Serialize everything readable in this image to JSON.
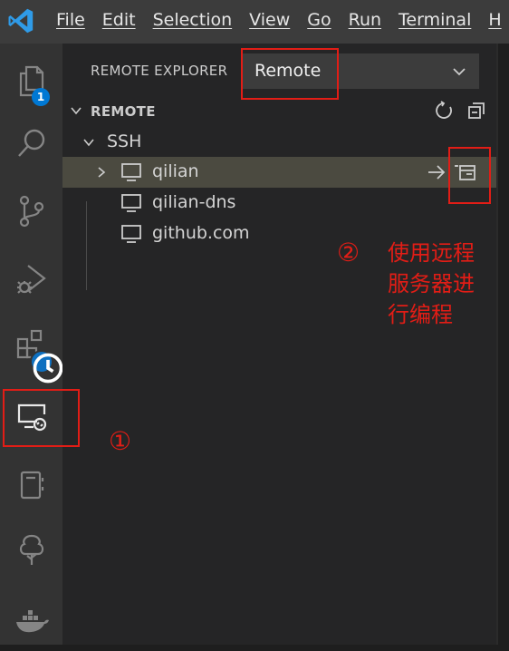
{
  "menu": [
    "File",
    "Edit",
    "Selection",
    "View",
    "Go",
    "Run",
    "Terminal",
    "H"
  ],
  "activity_bar": {
    "explorer_badge": "1",
    "icons": [
      "explorer-icon",
      "search-icon",
      "source-control-icon",
      "run-debug-icon",
      "extensions-icon",
      "remote-explorer-icon",
      "notebook-icon",
      "tree-icon",
      "docker-icon"
    ]
  },
  "sidebar": {
    "header_title": "REMOTE EXPLORER",
    "selected_target": "Remote",
    "section_title": "REMOTE",
    "ssh_group": "SSH",
    "hosts": [
      {
        "name": "qilian"
      },
      {
        "name": "qilian-dns"
      },
      {
        "name": "github.com"
      }
    ]
  },
  "annotations": {
    "one": "①",
    "two": "②",
    "two_text": [
      "使用远程",
      "服务器进",
      "行编程"
    ]
  },
  "colors": {
    "accent": "#0078d4",
    "annotation": "#e21d16",
    "selected_row": "#4b4a40"
  }
}
